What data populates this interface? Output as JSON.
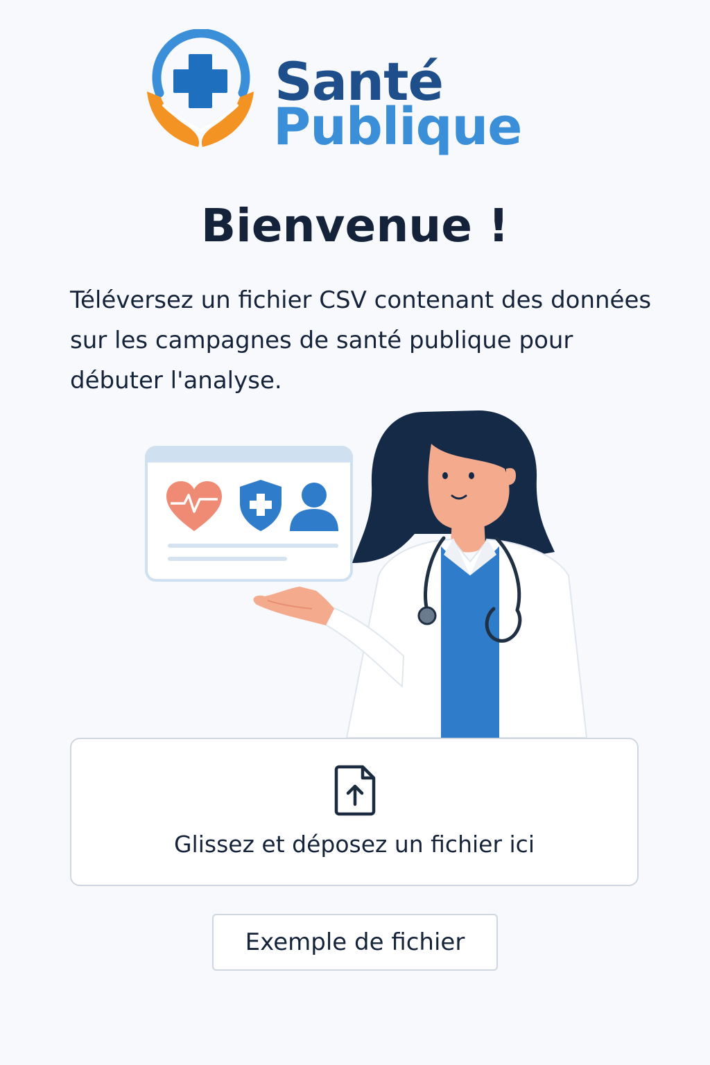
{
  "brand": {
    "line1": "Santé",
    "line2": "Publique",
    "colors": {
      "dark_blue": "#1f4f8a",
      "light_blue": "#3a8fd8",
      "orange": "#f39323"
    },
    "icon": "cross-in-hands-icon"
  },
  "welcome": {
    "title": "Bienvenue !",
    "description": "Téléversez un fichier CSV contenant des données sur les campagnes de santé publique pour débuter l'analyse."
  },
  "illustration": {
    "subject": "doctor",
    "card_icons": [
      "heart-pulse-icon",
      "shield-cross-icon",
      "user-icon"
    ]
  },
  "upload": {
    "dropzone_label": "Glissez et déposez un fichier ici",
    "icon": "file-upload-icon"
  },
  "actions": {
    "example_file_label": "Exemple de fichier"
  }
}
